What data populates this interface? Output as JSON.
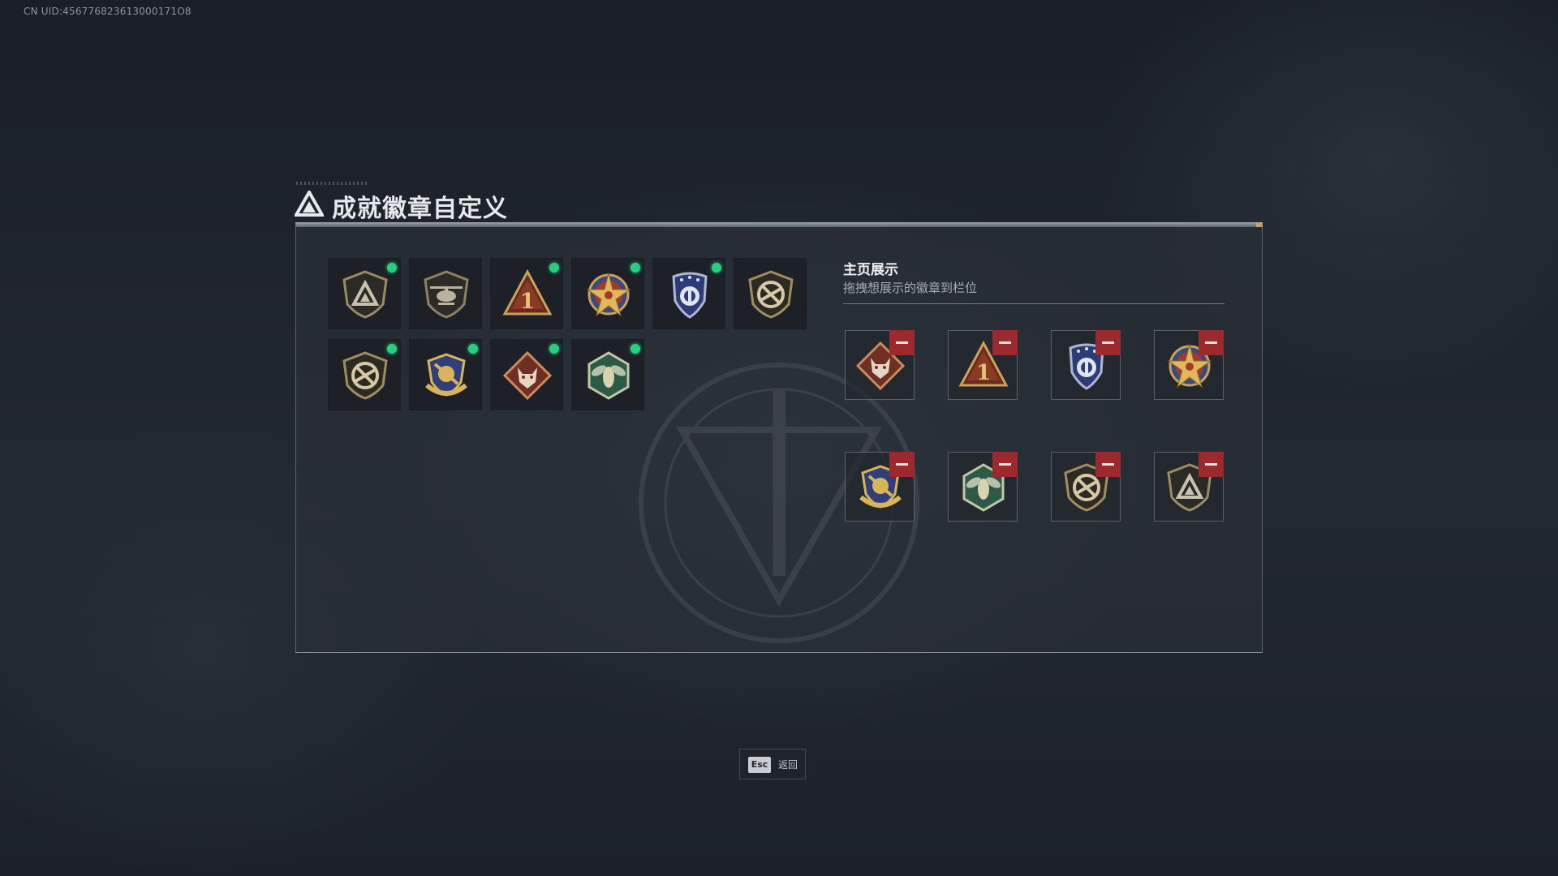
{
  "uid": "CN UID:456776823613000171O8",
  "header": {
    "title": "成就徽章自定义",
    "logo_icon": "delta-triangle-icon"
  },
  "showcase": {
    "title": "主页展示",
    "subtitle": "拖拽想展示的徽章到栏位",
    "remove_icon": "minus-icon"
  },
  "colors": {
    "new_indicator": "#27d07f",
    "remove": "#9b2a2e",
    "gold": "#c8a266"
  },
  "badges": [
    {
      "name": "delta-shield-badge-icon",
      "new": true
    },
    {
      "name": "helicopter-shield-badge-icon",
      "new": false
    },
    {
      "name": "number-one-triangle-badge-icon",
      "new": true
    },
    {
      "name": "star-medal-badge-icon",
      "new": true
    },
    {
      "name": "police-shield-badge-icon",
      "new": true
    },
    {
      "name": "no-rifle-shield-badge-icon",
      "new": false
    },
    {
      "name": "no-rifle-shield-badge-icon",
      "new": true
    },
    {
      "name": "gold-crest-badge-icon",
      "new": true
    },
    {
      "name": "wolf-diamond-badge-icon",
      "new": true
    },
    {
      "name": "wasp-hexagon-badge-icon",
      "new": true
    }
  ],
  "showcase_slots": [
    "wolf-diamond-badge-icon",
    "number-one-triangle-badge-icon",
    "police-shield-badge-icon",
    "star-medal-badge-icon",
    "gold-crest-badge-icon",
    "wasp-hexagon-badge-icon",
    "no-rifle-shield-badge-icon",
    "delta-shield-badge-icon"
  ],
  "footer": {
    "key": "Esc",
    "label": "返回"
  }
}
